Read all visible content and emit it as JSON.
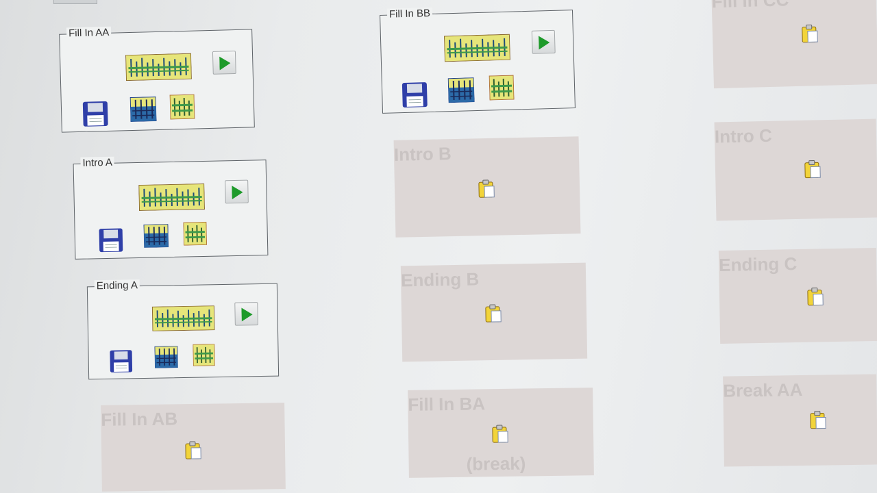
{
  "panels": [
    {
      "id": "fill-in-aa",
      "title": "Fill In AA",
      "active": true
    },
    {
      "id": "intro-a",
      "title": "Intro A",
      "active": true
    },
    {
      "id": "ending-a",
      "title": "Ending A",
      "active": true
    },
    {
      "id": "fill-in-ab",
      "title": "Fill In AB",
      "active": false
    },
    {
      "id": "fill-in-bb",
      "title": "Fill In BB",
      "active": true
    },
    {
      "id": "intro-b",
      "title": "Intro B",
      "active": false
    },
    {
      "id": "ending-b",
      "title": "Ending B",
      "active": false
    },
    {
      "id": "fill-in-ba",
      "title": "Fill In BA",
      "subtitle": "(break)",
      "active": false
    },
    {
      "id": "fill-in-cc",
      "title": "Fill In CC",
      "active": false
    },
    {
      "id": "intro-c",
      "title": "Intro C",
      "active": false
    },
    {
      "id": "ending-c",
      "title": "Ending C",
      "active": false
    },
    {
      "id": "break-aa",
      "title": "Break AA",
      "active": false
    }
  ],
  "icons": {
    "play": "play-icon",
    "save": "floppy-disk-icon",
    "pattern": "pattern-grid-icon",
    "notes": "note-grid-icon",
    "levels": "bar-levels-icon",
    "paste": "clipboard-icon"
  },
  "colors": {
    "play_green": "#1e9a2a",
    "floppy_blue": "#2f3fa8",
    "icon_yellow": "#e6e57a",
    "clipboard_yellow": "#f2d43a"
  }
}
